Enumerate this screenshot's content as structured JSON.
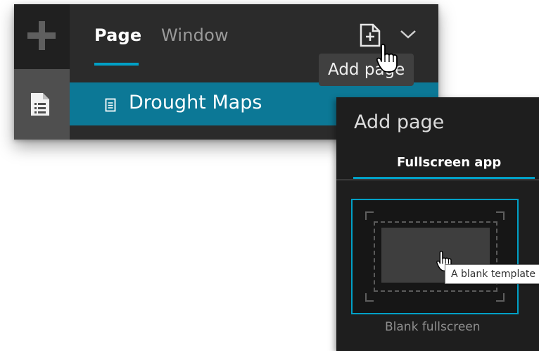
{
  "header": {
    "tabs": [
      {
        "label": "Page",
        "active": true
      },
      {
        "label": "Window",
        "active": false
      }
    ],
    "add_page_tooltip": "Add page"
  },
  "pages": [
    {
      "label": "Drought Maps",
      "selected": true
    }
  ],
  "add_page_popup": {
    "title": "Add page",
    "tab": "Fullscreen app",
    "template": {
      "caption": "Blank fullscreen",
      "tooltip": "A blank template"
    }
  },
  "icons": {
    "sidebar_top": "plus-icon",
    "sidebar_bottom": "page-list-icon",
    "header_add": "add-page-icon",
    "header_menu": "chevron-down-icon",
    "row": "document-icon",
    "pointer": "hand-cursor-icon"
  },
  "colors": {
    "accent": "#00a0c6",
    "selected_row": "#0c7896",
    "panel_bg": "#2b2b2b",
    "popup_bg": "#1e1e1e"
  }
}
